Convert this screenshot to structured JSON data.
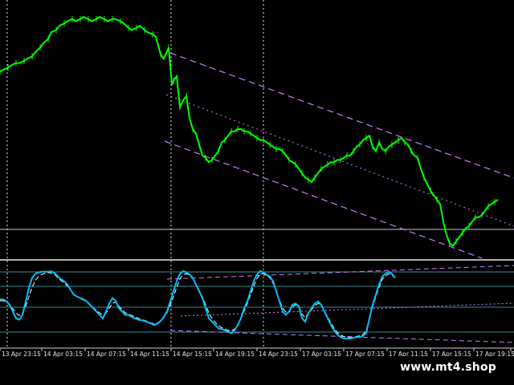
{
  "chart_data": {
    "type": "line",
    "title": "",
    "price_pane": {
      "series": [
        {
          "x_index": [
            0,
            4,
            10,
            14,
            20,
            24,
            30,
            34,
            40,
            44,
            50,
            54,
            60,
            64,
            70,
            74,
            80,
            84,
            90,
            94,
            100,
            104,
            110,
            114,
            120,
            124,
            130,
            134,
            140,
            144,
            150,
            154,
            160,
            164,
            170,
            174,
            180,
            184,
            190,
            194,
            200,
            204,
            210,
            214,
            216,
            220,
            224,
            228,
            232,
            236,
            240,
            244,
            248,
            252,
            256,
            260,
            264,
            268,
            272,
            276,
            280,
            284,
            288,
            292,
            296,
            300,
            304,
            308,
            312,
            316,
            320,
            324,
            328,
            332,
            336,
            340,
            344,
            348,
            352,
            356,
            360,
            364,
            368,
            372,
            376,
            380,
            384,
            388,
            392,
            396,
            400,
            404,
            408,
            412,
            416,
            420,
            424,
            428,
            432,
            436,
            440,
            444,
            448,
            452,
            456,
            460,
            464,
            468,
            472,
            476,
            480,
            484,
            488,
            492,
            496,
            500,
            504,
            508,
            512,
            516,
            520,
            524,
            528,
            532,
            536,
            540,
            544,
            548,
            552,
            556,
            560,
            564,
            568,
            572,
            576,
            580,
            584,
            588,
            592,
            596,
            600,
            604,
            608,
            612,
            616,
            620,
            624,
            628,
            632,
            636,
            640
          ],
          "close": [
            56,
            57,
            58,
            59,
            60,
            60,
            61,
            62,
            63,
            65,
            67,
            69,
            71,
            74,
            75,
            77,
            78,
            79,
            80,
            79,
            80,
            81,
            80,
            79,
            80,
            81,
            80,
            79,
            80,
            80,
            79,
            78,
            76,
            75,
            76,
            77,
            75,
            74,
            73,
            72,
            64,
            62,
            67,
            50,
            52,
            54,
            40,
            43,
            45,
            35,
            30,
            28,
            23,
            18,
            17,
            15,
            16,
            18,
            20,
            24,
            25,
            27,
            29,
            29,
            30,
            30,
            29,
            29,
            28,
            27,
            26,
            25,
            25,
            24,
            23,
            22,
            21,
            21,
            20,
            18,
            16,
            15,
            14,
            12,
            10,
            8,
            7,
            6,
            8,
            10,
            12,
            13,
            14,
            15,
            15,
            16,
            16,
            17,
            18,
            18,
            20,
            22,
            23,
            25,
            26,
            27,
            22,
            20,
            24,
            21,
            20,
            22,
            23,
            24,
            25,
            26,
            24,
            23,
            20,
            18,
            17,
            12,
            8,
            5,
            2,
            0,
            -2,
            -4,
            -12,
            -18,
            -22,
            -23,
            -21,
            -19,
            -17,
            -15,
            -14,
            -12,
            -10,
            -10,
            -9,
            -7,
            -5,
            -4,
            -3,
            -2
          ]
        }
      ],
      "horizontal_line": {
        "color": "#c8c8c8"
      },
      "channel": {
        "color": "#c77dff",
        "style": "dashed",
        "lines": [
          "upper",
          "middle",
          "lower"
        ]
      },
      "colors": {
        "candles": "#00ff00"
      }
    },
    "oscillator_pane": {
      "series": [
        {
          "x_index": [
            0,
            4,
            8,
            12,
            16,
            20,
            24,
            28,
            32,
            36,
            40,
            44,
            48,
            52,
            56,
            60,
            64,
            68,
            72,
            76,
            80,
            84,
            88,
            92,
            96,
            100,
            104,
            108,
            112,
            116,
            120,
            124,
            128,
            132,
            136,
            140,
            144,
            148,
            152,
            156,
            160,
            164,
            168,
            172,
            176,
            180,
            184,
            188,
            192,
            196,
            200,
            204,
            208,
            212,
            216,
            220,
            224,
            228,
            232,
            236,
            240,
            244,
            248,
            252,
            256,
            260,
            264,
            268,
            272,
            276,
            280,
            284,
            288,
            292,
            296,
            300,
            304,
            308,
            312,
            316,
            320,
            324,
            328,
            332,
            336,
            340,
            344,
            348,
            352,
            356,
            360,
            364,
            368,
            372,
            376,
            380,
            384,
            388,
            392,
            396,
            400,
            404,
            408,
            412,
            416,
            420,
            424,
            428,
            432,
            436,
            440,
            444,
            448,
            452,
            456,
            460,
            464,
            468,
            472,
            476,
            480,
            484,
            488,
            492,
            496,
            500,
            504,
            508,
            512,
            516,
            520,
            524,
            528,
            532,
            536,
            540,
            544,
            548,
            552,
            556,
            560,
            564,
            568,
            572,
            576,
            580,
            584,
            588,
            592,
            596,
            600,
            604,
            608,
            612,
            616,
            620,
            624,
            628,
            632,
            636,
            640
          ],
          "main": [
            58,
            58,
            55,
            50,
            40,
            30,
            28,
            35,
            55,
            75,
            90,
            96,
            98,
            99,
            99,
            99,
            100,
            97,
            92,
            88,
            85,
            80,
            72,
            65,
            62,
            60,
            58,
            55,
            50,
            45,
            40,
            35,
            30,
            40,
            52,
            60,
            56,
            45,
            40,
            35,
            35,
            32,
            30,
            28,
            27,
            26,
            24,
            22,
            20,
            22,
            26,
            32,
            40,
            55,
            70,
            85,
            96,
            100,
            98,
            95,
            90,
            80,
            70,
            60,
            45,
            30,
            25,
            20,
            15,
            14,
            12,
            10,
            8,
            12,
            20,
            30,
            45,
            55,
            70,
            85,
            95,
            100,
            98,
            95,
            92,
            85,
            70,
            55,
            40,
            35,
            40,
            50,
            52,
            48,
            30,
            25,
            38,
            45,
            52,
            55,
            50,
            40,
            30,
            20,
            12,
            6,
            2,
            0,
            0,
            0,
            1,
            2,
            2,
            4,
            8,
            30,
            50,
            65,
            80,
            92,
            96,
            99,
            96,
            90
          ],
          "signal": [
            56,
            56,
            54,
            50,
            44,
            38,
            34,
            38,
            48,
            62,
            76,
            86,
            92,
            95,
            97,
            98,
            97,
            95,
            90,
            86,
            82,
            78,
            72,
            66,
            62,
            59,
            57,
            54,
            50,
            46,
            42,
            38,
            35,
            38,
            45,
            52,
            54,
            48,
            43,
            38,
            36,
            34,
            32,
            30,
            28,
            27,
            25,
            23,
            22,
            23,
            26,
            31,
            38,
            50,
            62,
            76,
            88,
            95,
            96,
            94,
            89,
            80,
            71,
            62,
            50,
            38,
            30,
            24,
            19,
            16,
            14,
            12,
            11,
            14,
            20,
            29,
            41,
            52,
            65,
            78,
            89,
            96,
            96,
            94,
            90,
            82,
            70,
            57,
            45,
            39,
            40,
            47,
            50,
            48,
            36,
            31,
            38,
            43,
            49,
            52,
            49,
            41,
            32,
            23,
            15,
            9,
            5,
            3,
            2,
            2,
            2,
            3,
            4,
            6,
            12,
            30,
            47,
            62,
            76,
            88,
            93,
            96,
            94,
            90
          ]
        }
      ],
      "colors": {
        "main": "#00bfff",
        "signal": "#ffffff"
      },
      "level_lines_color": "#2f8f8f",
      "trend_lines_color": "#c77dff"
    },
    "x_tick_labels": [
      "13 Apr 23:15",
      "14 Apr 03:15",
      "14 Apr 07:15",
      "14 Apr 11:15",
      "14 Apr 15:15",
      "14 Apr 19:15",
      "14 Apr 23:15",
      "17 Apr 03:15",
      "17 Apr 07:15",
      "17 Apr 11:15",
      "17 Apr 15:15",
      "17 Apr 19:15",
      "1"
    ],
    "vertical_separators": [
      "14 Apr 03:15",
      "14 Apr 15:15",
      "14 Apr 23:15"
    ]
  },
  "watermark": "www.mt4.shop"
}
